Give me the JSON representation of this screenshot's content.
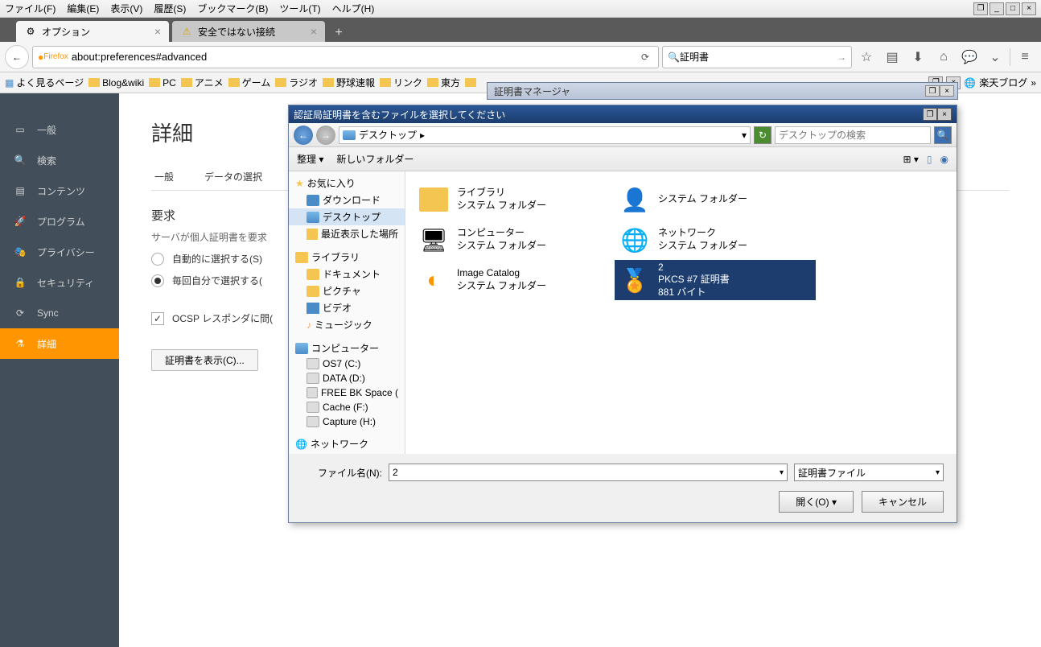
{
  "menubar": {
    "items": [
      "ファイル(F)",
      "編集(E)",
      "表示(V)",
      "履歴(S)",
      "ブックマーク(B)",
      "ツール(T)",
      "ヘルプ(H)"
    ]
  },
  "tabs": [
    {
      "label": "オプション",
      "icon": "gear"
    },
    {
      "label": "安全ではない接続",
      "icon": "warning"
    }
  ],
  "urlbar": {
    "brand": "Firefox",
    "url": "about:preferences#advanced"
  },
  "searchbar": {
    "value": "証明書"
  },
  "bookmarks": [
    {
      "label": "よく見るページ",
      "icon": "grid"
    },
    {
      "label": "Blog&wiki",
      "icon": "folder"
    },
    {
      "label": "PC",
      "icon": "folder"
    },
    {
      "label": "アニメ",
      "icon": "folder"
    },
    {
      "label": "ゲーム",
      "icon": "folder"
    },
    {
      "label": "ラジオ",
      "icon": "folder"
    },
    {
      "label": "野球速報",
      "icon": "folder"
    },
    {
      "label": "リンク",
      "icon": "folder"
    },
    {
      "label": "東方",
      "icon": "folder"
    }
  ],
  "bookmarks_right": "楽天ブログ",
  "sidebar": {
    "items": [
      {
        "label": "一般",
        "icon": "general"
      },
      {
        "label": "検索",
        "icon": "search"
      },
      {
        "label": "コンテンツ",
        "icon": "content"
      },
      {
        "label": "プログラム",
        "icon": "applications"
      },
      {
        "label": "プライバシー",
        "icon": "privacy"
      },
      {
        "label": "セキュリティ",
        "icon": "security"
      },
      {
        "label": "Sync",
        "icon": "sync"
      },
      {
        "label": "詳細",
        "icon": "advanced",
        "active": true
      }
    ]
  },
  "main": {
    "title": "詳細",
    "subtabs": [
      "一般",
      "データの選択"
    ],
    "request_heading": "要求",
    "request_desc": "サーバが個人証明書を要求",
    "radio_auto": "自動的に選択する(S)",
    "radio_manual": "毎回自分で選択する(",
    "check_ocsp": "OCSP レスポンダに問(",
    "btn_cert": "証明書を表示(C)..."
  },
  "cert_mgr": {
    "title": "証明書マネージャ"
  },
  "file_dialog": {
    "title": "認証局証明書を含むファイルを選択してください",
    "path_label": "デスクトップ",
    "search_placeholder": "デスクトップの検索",
    "toolbar": {
      "organize": "整理",
      "newfolder": "新しいフォルダー"
    },
    "tree": {
      "favorites": "お気に入り",
      "downloads": "ダウンロード",
      "desktop": "デスクトップ",
      "recent": "最近表示した場所",
      "library": "ライブラリ",
      "documents": "ドキュメント",
      "pictures": "ピクチャ",
      "videos": "ビデオ",
      "music": "ミュージック",
      "computer": "コンピューター",
      "drives": [
        "OS7 (C:)",
        "DATA (D:)",
        "FREE BK Space (",
        "Cache (F:)",
        "Capture (H:)"
      ],
      "network": "ネットワーク"
    },
    "files": [
      {
        "name": "ライブラリ",
        "sub": "システム フォルダー",
        "icon": "lib"
      },
      {
        "name": "",
        "sub": "システム フォルダー",
        "icon": "user"
      },
      {
        "name": "コンピューター",
        "sub": "システム フォルダー",
        "icon": "computer"
      },
      {
        "name": "ネットワーク",
        "sub": "システム フォルダー",
        "icon": "network"
      },
      {
        "name": "Image Catalog",
        "sub": "システム フォルダー",
        "icon": "catalog"
      },
      {
        "name": "2",
        "sub": "PKCS #7 証明書",
        "sub2": "881 バイト",
        "icon": "cert",
        "selected": true
      }
    ],
    "filename_label": "ファイル名(N):",
    "filename_value": "2",
    "filetype_value": "証明書ファイル",
    "btn_open": "開く(O)",
    "btn_cancel": "キャンセル"
  }
}
